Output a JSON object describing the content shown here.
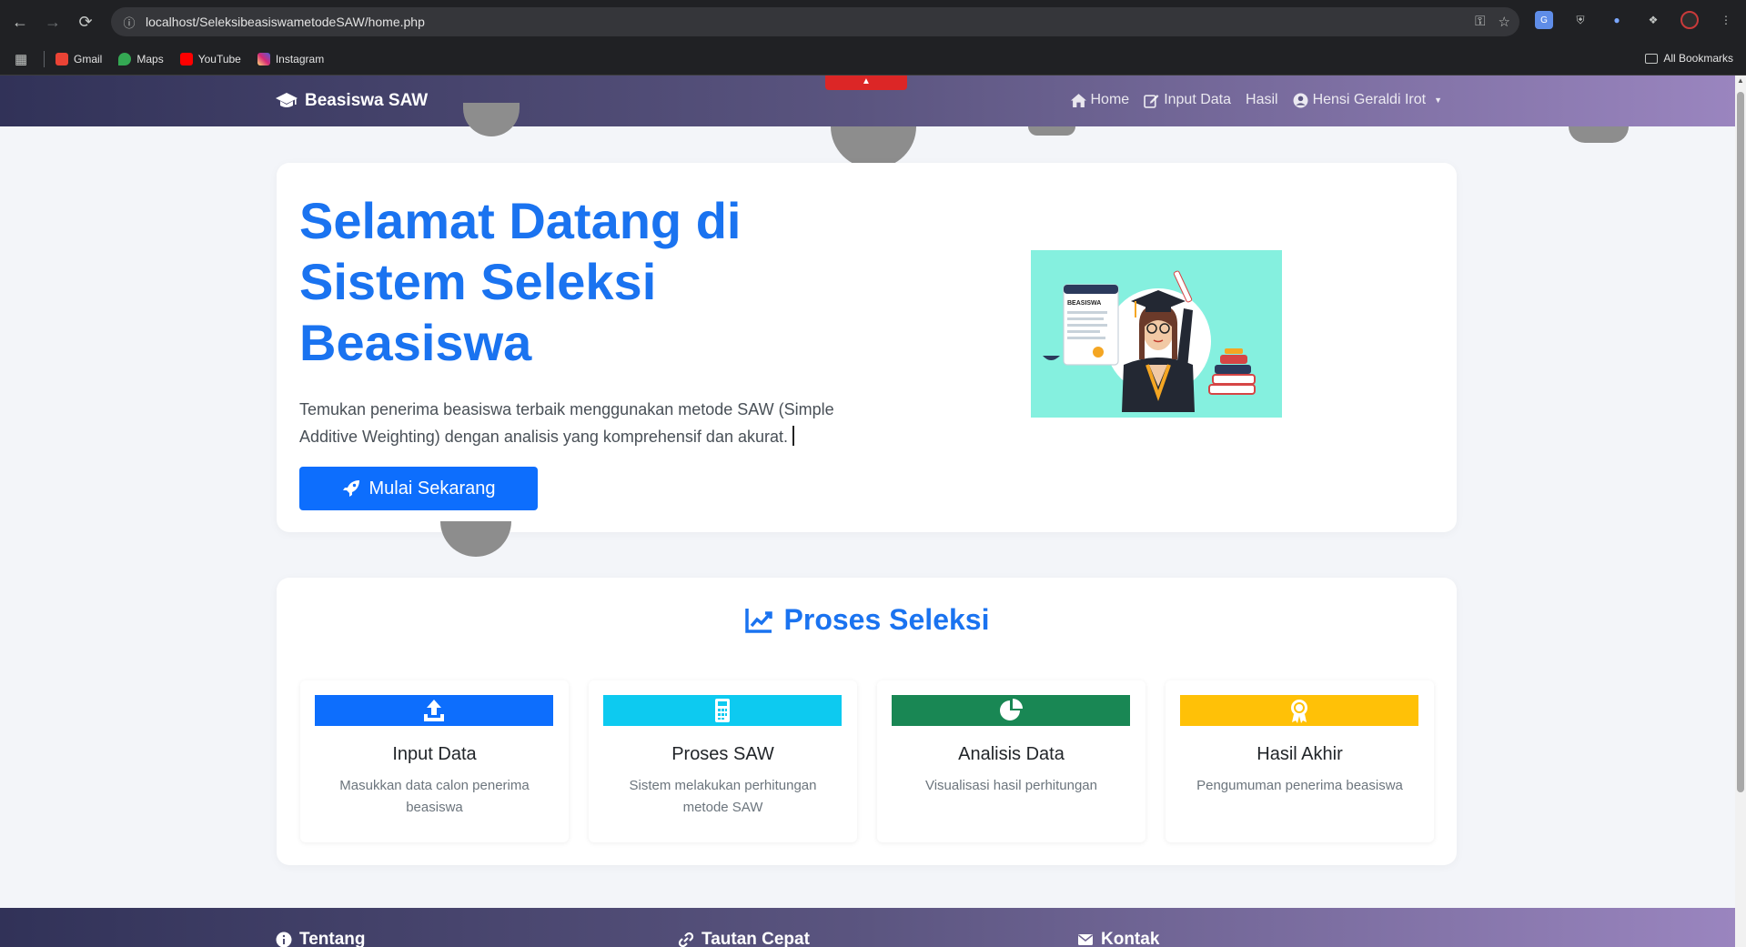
{
  "browser": {
    "url": "localhost/SeleksibeasiswametodeSAW/home.php",
    "bookmarks": [
      {
        "label": "Gmail",
        "color": "#ea4335"
      },
      {
        "label": "Maps",
        "color": "#34a853"
      },
      {
        "label": "YouTube",
        "color": "#ff0000"
      },
      {
        "label": "Instagram",
        "color": "#d62976"
      }
    ],
    "all_bookmarks": "All Bookmarks"
  },
  "navbar": {
    "brand": "Beasiswa SAW",
    "links": [
      {
        "label": "Home",
        "icon": "home-icon"
      },
      {
        "label": "Input Data",
        "icon": "edit-icon"
      },
      {
        "label": "Hasil"
      },
      {
        "label": "Hensi Geraldi Irot",
        "icon": "user-circle-icon"
      }
    ]
  },
  "hero": {
    "title": "Selamat Datang di Sistem Seleksi Beasiswa",
    "description": "Temukan penerima beasiswa terbaik menggunakan metode SAW (Simple Additive Weighting) dengan analisis yang komprehensif dan akurat.",
    "cta": "Mulai Sekarang",
    "illustration_label": "BEASISWA"
  },
  "process": {
    "title": "Proses Seleksi",
    "steps": [
      {
        "title": "Input Data",
        "desc": "Masukkan data calon penerima beasiswa",
        "color": "#0d6efd",
        "icon": "upload-icon"
      },
      {
        "title": "Proses SAW",
        "desc": "Sistem melakukan perhitungan metode SAW",
        "color": "#0dcaf0",
        "icon": "calculator-icon"
      },
      {
        "title": "Analisis Data",
        "desc": "Visualisasi hasil perhitungan",
        "color": "#198754",
        "icon": "pie-chart-icon"
      },
      {
        "title": "Hasil Akhir",
        "desc": "Pengumuman penerima beasiswa",
        "color": "#ffc107",
        "icon": "award-icon"
      }
    ]
  },
  "footer": {
    "sections": [
      "Tentang",
      "Tautan Cepat",
      "Kontak"
    ]
  }
}
